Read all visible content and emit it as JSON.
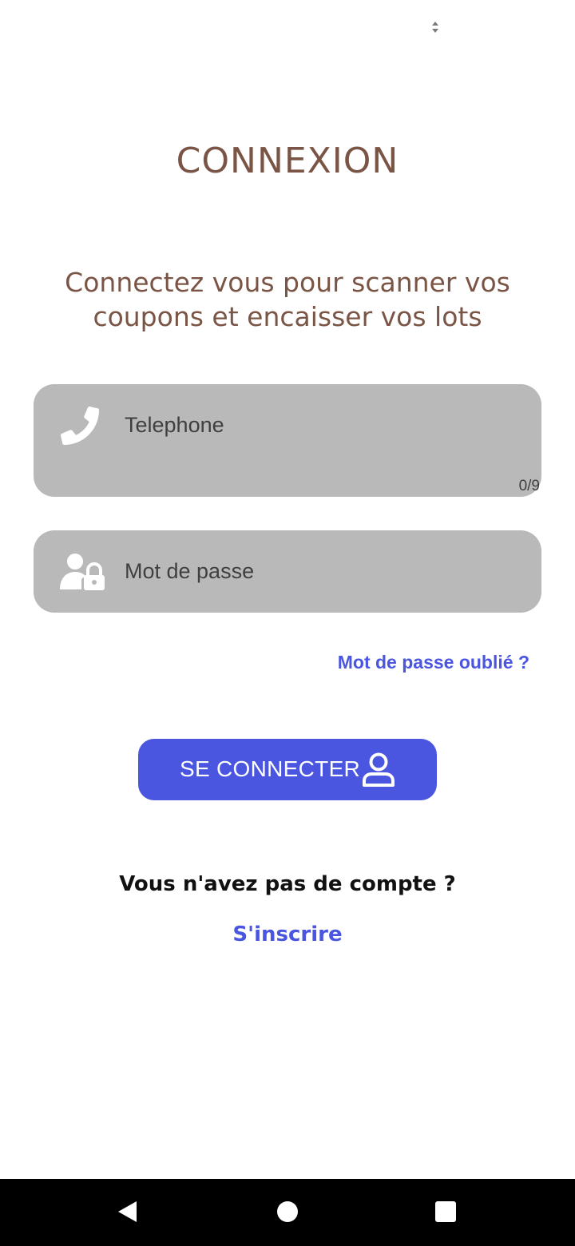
{
  "status_bar": {
    "icon": "sort-arrows-icon"
  },
  "login": {
    "title": "CONNEXION",
    "subtitle": "Connectez vous pour scanner vos coupons et encaisser vos lots",
    "phone_field": {
      "placeholder": "Telephone",
      "value": "",
      "counter": "0/9",
      "icon": "phone-icon"
    },
    "password_field": {
      "placeholder": "Mot de passe",
      "value": "",
      "icon": "user-lock-icon"
    },
    "forgot_password_link": "Mot de passe oublié ?",
    "login_button": {
      "label": "SE CONNECTER",
      "icon": "user-icon"
    },
    "no_account_text": "Vous n'avez pas de compte ?",
    "signup_link": "S'inscrire"
  },
  "nav_bar": {
    "back": "back-triangle-icon",
    "home": "home-circle-icon",
    "recents": "recents-square-icon"
  },
  "colors": {
    "accent": "#4a55e0",
    "brown": "#7a5545",
    "field_bg": "#b9b9b9",
    "navbar_bg": "#000000"
  }
}
